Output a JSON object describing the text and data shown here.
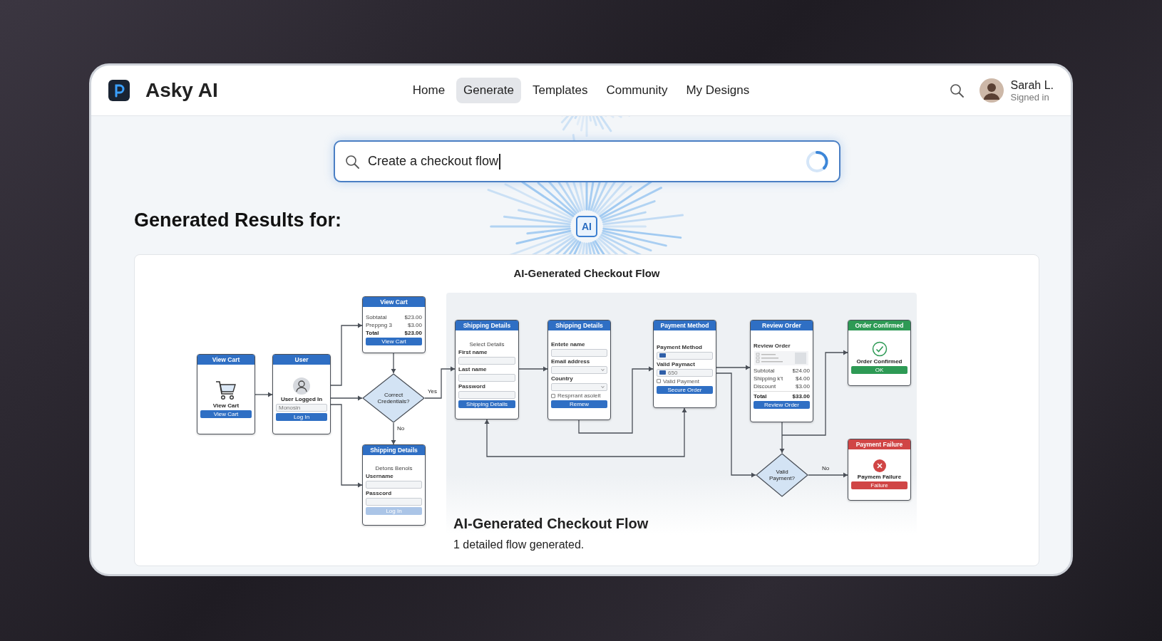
{
  "app": {
    "name": "Asky AI"
  },
  "nav": [
    {
      "label": "Home",
      "selected": false
    },
    {
      "label": "Generate",
      "selected": true
    },
    {
      "label": "Templates",
      "selected": false
    },
    {
      "label": "Community",
      "selected": false
    },
    {
      "label": "My Designs",
      "selected": false
    }
  ],
  "user": {
    "name": "Sarah L.",
    "status": "Signed in"
  },
  "ai_badges": [
    "AI"
  ],
  "search": {
    "value": "Create a checkout flow"
  },
  "results_heading": "Generated Results for:",
  "result": {
    "title": "AI-Generated Checkout Flow",
    "caption_title": "AI-Generated Checkout Flow",
    "caption": "1 detailed flow generated.",
    "flow": {
      "edge_labels": [
        "Yes",
        "No",
        "No"
      ],
      "nodes": [
        {
          "kind": "screen",
          "title": "View Cart",
          "color": "#2f6fc4",
          "rows": [
            {
              "kind": "cart"
            },
            {
              "kind": "heading",
              "text": "View Cart"
            },
            {
              "kind": "button",
              "text": "View Cart",
              "disabled": false
            }
          ]
        },
        {
          "kind": "screen",
          "title": "User",
          "color": "#2f6fc4",
          "rows": [
            {
              "kind": "avatar"
            },
            {
              "kind": "heading",
              "text": "User Logged In"
            },
            {
              "kind": "field",
              "placeholder": "Monosin"
            },
            {
              "kind": "button",
              "text": "Log In",
              "disabled": false
            }
          ]
        },
        {
          "kind": "screen",
          "title": "View Cart",
          "color": "#2f6fc4",
          "rows": [
            {
              "kind": "value",
              "label": "Sobtatal",
              "amount": "$23.00"
            },
            {
              "kind": "value",
              "label": "Preppng 3",
              "amount": "$3.00"
            },
            {
              "kind": "total",
              "label": "Total",
              "amount": "$23.00"
            },
            {
              "kind": "button",
              "text": "View Cart",
              "disabled": false
            }
          ]
        },
        {
          "kind": "decision",
          "title": "Correct Credentials?"
        },
        {
          "kind": "screen",
          "title": "Shipping Details",
          "color": "#2f6fc4",
          "rows": [
            {
              "kind": "caption",
              "text": "Detons Benols"
            },
            {
              "kind": "label",
              "text": "Username"
            },
            {
              "kind": "field"
            },
            {
              "kind": "label",
              "text": "Passcord"
            },
            {
              "kind": "field"
            },
            {
              "kind": "button",
              "text": "Log In",
              "disabled": true
            }
          ]
        },
        {
          "kind": "screen",
          "title": "Shipping Details",
          "color": "#2f6fc4",
          "rows": [
            {
              "kind": "caption",
              "text": "Select Details"
            },
            {
              "kind": "label",
              "text": "First name"
            },
            {
              "kind": "field"
            },
            {
              "kind": "label",
              "text": "Last name"
            },
            {
              "kind": "field"
            },
            {
              "kind": "label",
              "text": "Password"
            },
            {
              "kind": "field"
            },
            {
              "kind": "button",
              "text": "Shipping Details",
              "disabled": false
            }
          ]
        },
        {
          "kind": "screen",
          "title": "Shipping Details",
          "color": "#2f6fc4",
          "rows": [
            {
              "kind": "label",
              "text": "Entete name"
            },
            {
              "kind": "field"
            },
            {
              "kind": "label",
              "text": "Email address"
            },
            {
              "kind": "select"
            },
            {
              "kind": "label",
              "text": "Country"
            },
            {
              "kind": "select"
            },
            {
              "kind": "checkbox",
              "text": "Resprrant asoleit",
              "checked": false
            },
            {
              "kind": "button",
              "text": "Remew",
              "disabled": false
            }
          ]
        },
        {
          "kind": "screen",
          "title": "Payment Method",
          "color": "#2f6fc4",
          "rows": [
            {
              "kind": "label",
              "text": "Payment Method"
            },
            {
              "kind": "card_field"
            },
            {
              "kind": "label",
              "text": "Valid Paymact"
            },
            {
              "kind": "card_field",
              "value": "650"
            },
            {
              "kind": "checkbox",
              "text": "Valid Payment",
              "checked": false
            },
            {
              "kind": "button",
              "text": "Secure Order",
              "disabled": false
            }
          ]
        },
        {
          "kind": "screen",
          "title": "Review Order",
          "color": "#2f6fc4",
          "rows": [
            {
              "kind": "label",
              "text": "Review Order"
            },
            {
              "kind": "summary"
            },
            {
              "kind": "value",
              "label": "Subtotal",
              "amount": "$24.00"
            },
            {
              "kind": "value",
              "label": "Shipping k't",
              "amount": "$4.00"
            },
            {
              "kind": "value",
              "label": "Discount",
              "amount": "$3.00"
            },
            {
              "kind": "divider"
            },
            {
              "kind": "total",
              "label": "Total",
              "amount": "$33.00"
            },
            {
              "kind": "button",
              "text": "Review Order",
              "disabled": false
            }
          ]
        },
        {
          "kind": "screen",
          "title": "Order Confirmed",
          "color": "#2e9a55",
          "rows": [
            {
              "kind": "success"
            },
            {
              "kind": "heading",
              "text": "Order Confirmed"
            },
            {
              "kind": "button",
              "text": "OK",
              "disabled": false
            }
          ]
        },
        {
          "kind": "decision",
          "title": "Valid Payment?"
        },
        {
          "kind": "screen",
          "title": "Payment Failure",
          "color": "#d04545",
          "rows": [
            {
              "kind": "error"
            },
            {
              "kind": "heading",
              "text": "Paymem Failure"
            },
            {
              "kind": "button",
              "text": "Failure",
              "disabled": false
            }
          ]
        }
      ]
    }
  }
}
